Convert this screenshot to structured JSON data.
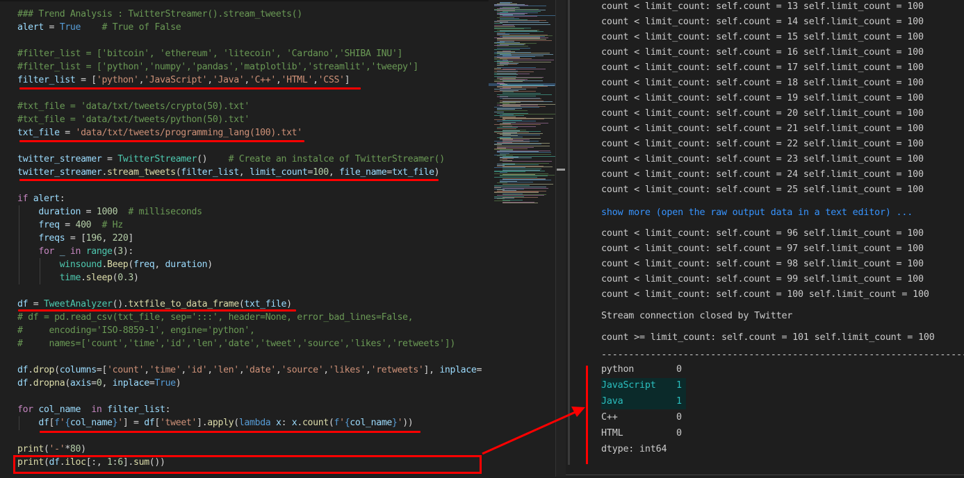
{
  "editor": {
    "language": "python",
    "lines": [
      {
        "id": "l1",
        "text": "### Trend Analysis : TwitterStreamer().stream_tweets()"
      },
      {
        "id": "l2",
        "text": "alert = True    # True of False"
      },
      {
        "id": "l3",
        "text": ""
      },
      {
        "id": "l4",
        "text": "#filter_list = ['bitcoin', 'ethereum', 'litecoin', 'Cardano','SHIBA INU']"
      },
      {
        "id": "l5",
        "text": "#filter_list = ['python','numpy','pandas','matplotlib','streamlit','tweepy']"
      },
      {
        "id": "l6",
        "text": "filter_list = ['python','JavaScript','Java','C++','HTML','CSS']"
      },
      {
        "id": "l7",
        "text": ""
      },
      {
        "id": "l8",
        "text": "#txt_file = 'data/txt/tweets/crypto(50).txt'"
      },
      {
        "id": "l9",
        "text": "#txt_file = 'data/txt/tweets/python(50).txt'"
      },
      {
        "id": "l10",
        "text": "txt_file = 'data/txt/tweets/programming_lang(100).txt'"
      },
      {
        "id": "l11",
        "text": ""
      },
      {
        "id": "l12",
        "text": "twitter_streamer = TwitterStreamer()    # Create an instalce of TwitterStreamer()"
      },
      {
        "id": "l13",
        "text": "twitter_streamer.stream_tweets(filter_list, limit_count=100, file_name=txt_file)"
      },
      {
        "id": "l14",
        "text": ""
      },
      {
        "id": "l15",
        "text": "if alert:"
      },
      {
        "id": "l16",
        "text": "    duration = 1000  # milliseconds"
      },
      {
        "id": "l17",
        "text": "    freq = 400  # Hz"
      },
      {
        "id": "l18",
        "text": "    freqs = [196, 220]"
      },
      {
        "id": "l19",
        "text": "    for _ in range(3):"
      },
      {
        "id": "l20",
        "text": "        winsound.Beep(freq, duration)"
      },
      {
        "id": "l21",
        "text": "        time.sleep(0.3)"
      },
      {
        "id": "l22",
        "text": ""
      },
      {
        "id": "l23",
        "text": "df = TweetAnalyzer().txtfile_to_data_frame(txt_file)"
      },
      {
        "id": "l24",
        "text": "# df = pd.read_csv(txt_file, sep=':::', header=None, error_bad_lines=False,"
      },
      {
        "id": "l25",
        "text": "#     encoding='ISO-8859-1', engine='python',"
      },
      {
        "id": "l26",
        "text": "#     names=['count','time','id','len','date','tweet','source','likes','retweets'])"
      },
      {
        "id": "l27",
        "text": ""
      },
      {
        "id": "l28",
        "text": "df.drop(columns=['count','time','id','len','date','source','likes','retweets'], inplace="
      },
      {
        "id": "l29",
        "text": "df.dropna(axis=0, inplace=True)"
      },
      {
        "id": "l30",
        "text": ""
      },
      {
        "id": "l31",
        "text": "for col_name  in filter_list:"
      },
      {
        "id": "l32",
        "text": "    df[f'{col_name}'] = df['tweet'].apply(lambda x: x.count(f'{col_name}'))"
      },
      {
        "id": "l33",
        "text": ""
      },
      {
        "id": "l34",
        "text": "print('-'*80)"
      },
      {
        "id": "l35",
        "text": "print(df.iloc[:, 1:6].sum())"
      }
    ],
    "highlighted_lines": [
      "l6",
      "l10",
      "l13",
      "l23",
      "l32"
    ],
    "boxed_line": "l35"
  },
  "output": {
    "loop_lines_top": [
      "count < limit_count: self.count = 13 self.limit_count = 100",
      "count < limit_count: self.count = 14 self.limit_count = 100",
      "count < limit_count: self.count = 15 self.limit_count = 100",
      "count < limit_count: self.count = 16 self.limit_count = 100",
      "count < limit_count: self.count = 17 self.limit_count = 100",
      "count < limit_count: self.count = 18 self.limit_count = 100",
      "count < limit_count: self.count = 19 self.limit_count = 100",
      "count < limit_count: self.count = 20 self.limit_count = 100",
      "count < limit_count: self.count = 21 self.limit_count = 100",
      "count < limit_count: self.count = 22 self.limit_count = 100",
      "count < limit_count: self.count = 23 self.limit_count = 100",
      "count < limit_count: self.count = 24 self.limit_count = 100",
      "count < limit_count: self.count = 25 self.limit_count = 100"
    ],
    "show_more_label": "show more (open the raw output data in a text editor) ...",
    "loop_lines_bottom": [
      "count < limit_count: self.count = 96 self.limit_count = 100",
      "count < limit_count: self.count = 97 self.limit_count = 100",
      "count < limit_count: self.count = 98 self.limit_count = 100",
      "count < limit_count: self.count = 99 self.limit_count = 100",
      "count < limit_count: self.count = 100 self.limit_count = 100"
    ],
    "stream_closed": "Stream connection closed by Twitter",
    "final_count": "count >= limit_count: self.count = 101 self.limit_count = 100",
    "separator": "--------------------------------------------------------------------------------",
    "sum_rows": [
      {
        "name": "python",
        "value": "0",
        "highlight": false
      },
      {
        "name": "JavaScript",
        "value": "1",
        "highlight": true
      },
      {
        "name": "Java",
        "value": "1",
        "highlight": true
      },
      {
        "name": "C++",
        "value": "0",
        "highlight": false
      },
      {
        "name": "HTML",
        "value": "0",
        "highlight": false
      }
    ],
    "dtype": "dtype: int64"
  },
  "annotations": {
    "color": "#ff0000"
  }
}
